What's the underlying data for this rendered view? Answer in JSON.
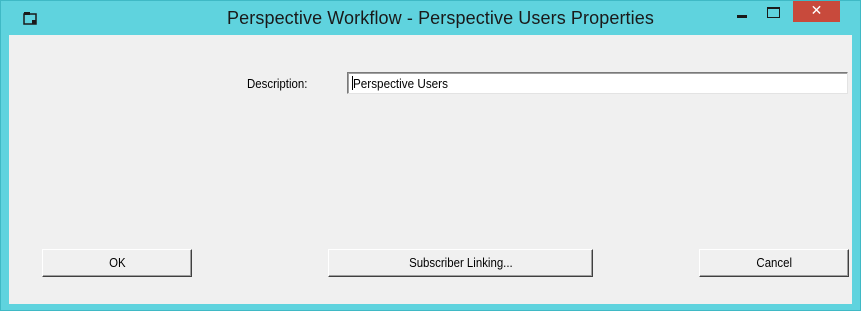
{
  "window": {
    "title": "Perspective Workflow - Perspective Users Properties",
    "icon": "window-icon",
    "controls": {
      "minimize_icon": "minimize-icon",
      "maximize_icon": "maximize-icon",
      "close_label": "✕"
    },
    "colors": {
      "titlebar": "#5fd3de",
      "close": "#c84a3c",
      "client": "#f0f0f0"
    }
  },
  "form": {
    "description_label": "Description:",
    "description_value": "Perspective Users"
  },
  "buttons": {
    "ok": "OK",
    "subscriber_linking": "Subscriber Linking...",
    "cancel": "Cancel"
  }
}
